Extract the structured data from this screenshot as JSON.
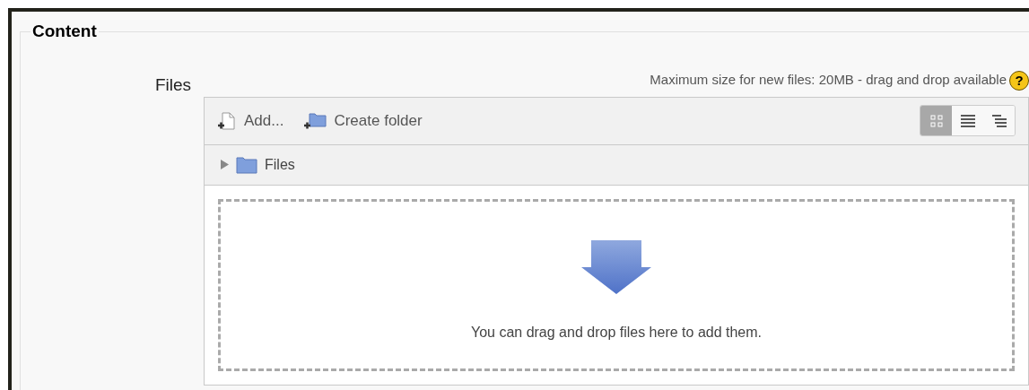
{
  "fieldset": {
    "legend": "Content"
  },
  "field": {
    "label": "Files",
    "note": "Maximum size for new files: 20MB - drag and drop available",
    "help": "?"
  },
  "toolbar": {
    "buttons": [
      {
        "kind": "add-file",
        "label": "Add..."
      },
      {
        "kind": "create-folder",
        "label": "Create folder"
      }
    ],
    "view_modes": [
      {
        "kind": "icons",
        "selected": true
      },
      {
        "kind": "list",
        "selected": false
      },
      {
        "kind": "tree",
        "selected": false
      }
    ]
  },
  "path": {
    "label": "Files"
  },
  "drop_area": {
    "message": "You can drag and drop files here to add them."
  }
}
